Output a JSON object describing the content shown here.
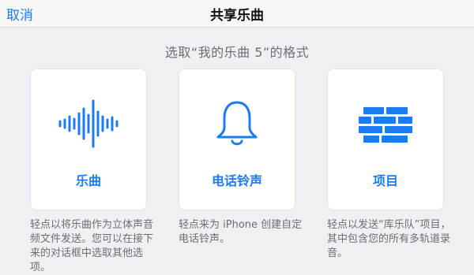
{
  "navbar": {
    "cancel_label": "取消",
    "title": "共享乐曲"
  },
  "subtitle": "选取“我的乐曲 5”的格式",
  "accent_color": "#1a7cf5",
  "options": [
    {
      "icon": "waveform-icon",
      "label": "乐曲",
      "description": "轻点以将乐曲作为立体声音频文件发送。您可以在接下来的对话框中选取其他选项。"
    },
    {
      "icon": "bell-icon",
      "label": "电话铃声",
      "description": "轻点来为 iPhone 创建自定电话铃声。"
    },
    {
      "icon": "brick-wall-icon",
      "label": "项目",
      "description": "轻点以发送“库乐队”项目，其中包含您的所有多轨道录音。"
    }
  ]
}
